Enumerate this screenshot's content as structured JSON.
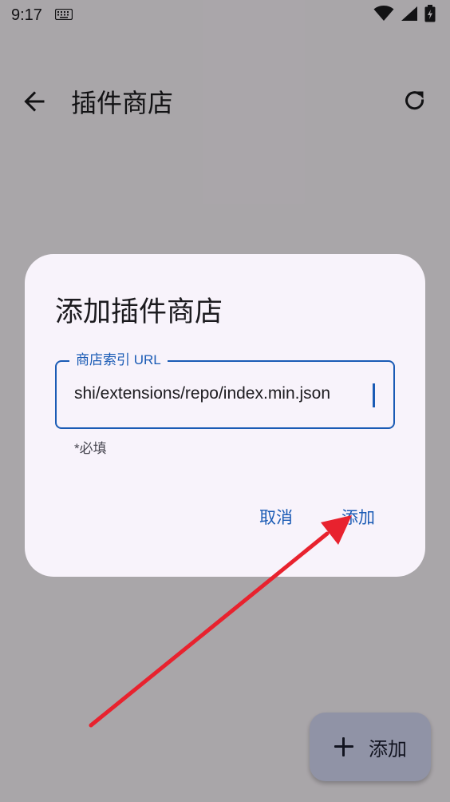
{
  "status_bar": {
    "time": "9:17",
    "icons": [
      "keyboard-icon",
      "wifi-icon",
      "signal-icon",
      "battery-icon"
    ]
  },
  "app_bar": {
    "title": "插件商店",
    "back_icon": "arrow-back-icon",
    "refresh_icon": "refresh-icon"
  },
  "fab": {
    "label": "添加",
    "icon": "plus-icon"
  },
  "dialog": {
    "title": "添加插件商店",
    "field": {
      "label": "商店索引 URL",
      "value": "shi/extensions/repo/index.min.json",
      "helper": "*必填"
    },
    "buttons": {
      "cancel": "取消",
      "confirm": "添加"
    }
  },
  "colors": {
    "accent": "#1a5bb5",
    "scrim": "#000000",
    "annotation_arrow": "#e8222e"
  }
}
